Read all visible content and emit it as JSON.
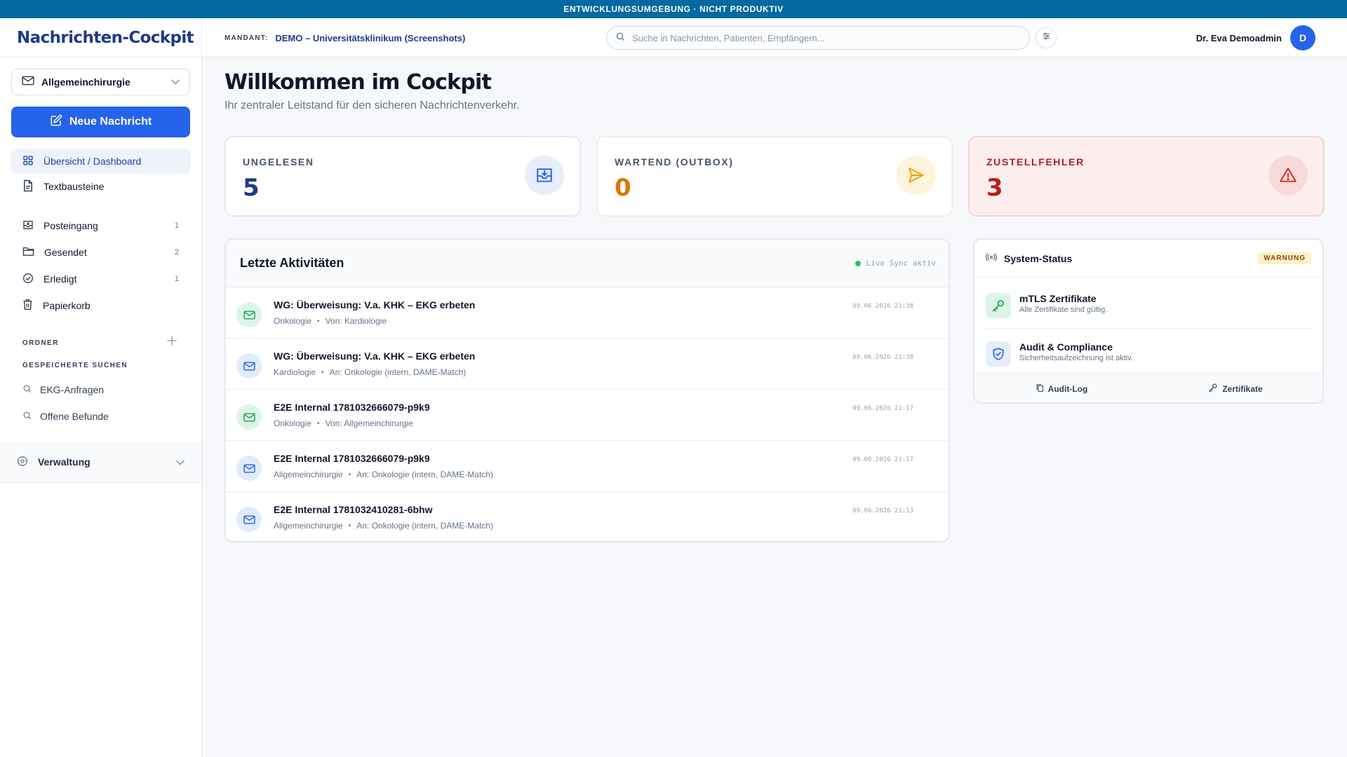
{
  "env_banner": "ENTWICKLUNGSUMGEBUNG · NICHT PRODUKTIV",
  "app": {
    "title": "Nachrichten-Cockpit"
  },
  "header": {
    "mandant_label": "MANDANT:",
    "mandant_value": "DEMO – Universitätsklinikum (Screenshots)",
    "search_placeholder": "Suche in Nachrichten, Patienten, Empfängern...",
    "user_name": "Dr. Eva Demoadmin",
    "avatar_initial": "D"
  },
  "sidebar": {
    "mailbox": "Allgemeinchirurgie",
    "new_message": "Neue Nachricht",
    "nav_top": [
      {
        "label": "Übersicht / Dashboard",
        "icon": "grid-icon",
        "active": true
      },
      {
        "label": "Textbausteine",
        "icon": "document-icon"
      }
    ],
    "folders_nav": [
      {
        "label": "Posteingang",
        "count": "1",
        "icon": "inbox-icon"
      },
      {
        "label": "Gesendet",
        "count": "2",
        "icon": "folder-icon"
      },
      {
        "label": "Erledigt",
        "count": "1",
        "icon": "check-circle-icon"
      },
      {
        "label": "Papierkorb",
        "count": "",
        "icon": "trash-icon"
      }
    ],
    "folders_section": "ORDNER",
    "saved_section": "GESPEICHERTE SUCHEN",
    "saved_searches": [
      "EKG-Anfragen",
      "Offene Befunde"
    ],
    "admin": "Verwaltung"
  },
  "main": {
    "title": "Willkommen im Cockpit",
    "subtitle": "Ihr zentraler Leitstand für den sicheren Nachrichtenverkehr.",
    "stats": [
      {
        "label": "UNGELESEN",
        "value": "5",
        "color": "#1e3a8a",
        "icon": "inbox-tray-icon"
      },
      {
        "label": "WARTEND (OUTBOX)",
        "value": "0",
        "color": "#d97706",
        "icon": "send-icon"
      },
      {
        "label": "ZUSTELLFEHLER",
        "value": "3",
        "color": "#b91c1c",
        "icon": "warning-icon"
      }
    ],
    "activity": {
      "title": "Letzte Aktivitäten",
      "live": "Live Sync aktiv",
      "rows": [
        {
          "subject": "WG: Überweisung: V.a. KHK – EKG erbeten",
          "org": "Onkologie",
          "detail": "Von: Kardiologie",
          "time": "09.06.2026 21:38",
          "direction": "in"
        },
        {
          "subject": "WG: Überweisung: V.a. KHK – EKG erbeten",
          "org": "Kardiologie",
          "detail": "An: Onkologie (intern, DAME-Match)",
          "time": "09.06.2026 21:38",
          "direction": "out"
        },
        {
          "subject": "E2E Internal 1781032666079-p9k9",
          "org": "Onkologie",
          "detail": "Von: Allgemeinchirurgie",
          "time": "09.06.2026 21:17",
          "direction": "in"
        },
        {
          "subject": "E2E Internal 1781032666079-p9k9",
          "org": "Allgemeinchirurgie",
          "detail": "An: Onkologie (intern, DAME-Match)",
          "time": "09.06.2026 21:17",
          "direction": "out"
        },
        {
          "subject": "E2E Internal 1781032410281-6bhw",
          "org": "Allgemeinchirurgie",
          "detail": "An: Onkologie (intern, DAME-Match)",
          "time": "09.06.2026 21:13",
          "direction": "out"
        }
      ]
    },
    "system_status": {
      "title": "System-Status",
      "badge": "WARNUNG",
      "items": [
        {
          "title": "mTLS Zertifikate",
          "desc": "Alle Zertifikate sind gültig.",
          "icon": "key-icon"
        },
        {
          "title": "Audit & Compliance",
          "desc": "Sicherheitsaufzeichnung ist aktiv.",
          "icon": "shield-check-icon"
        }
      ],
      "links": [
        "Audit-Log",
        "Zertifikate"
      ]
    }
  }
}
